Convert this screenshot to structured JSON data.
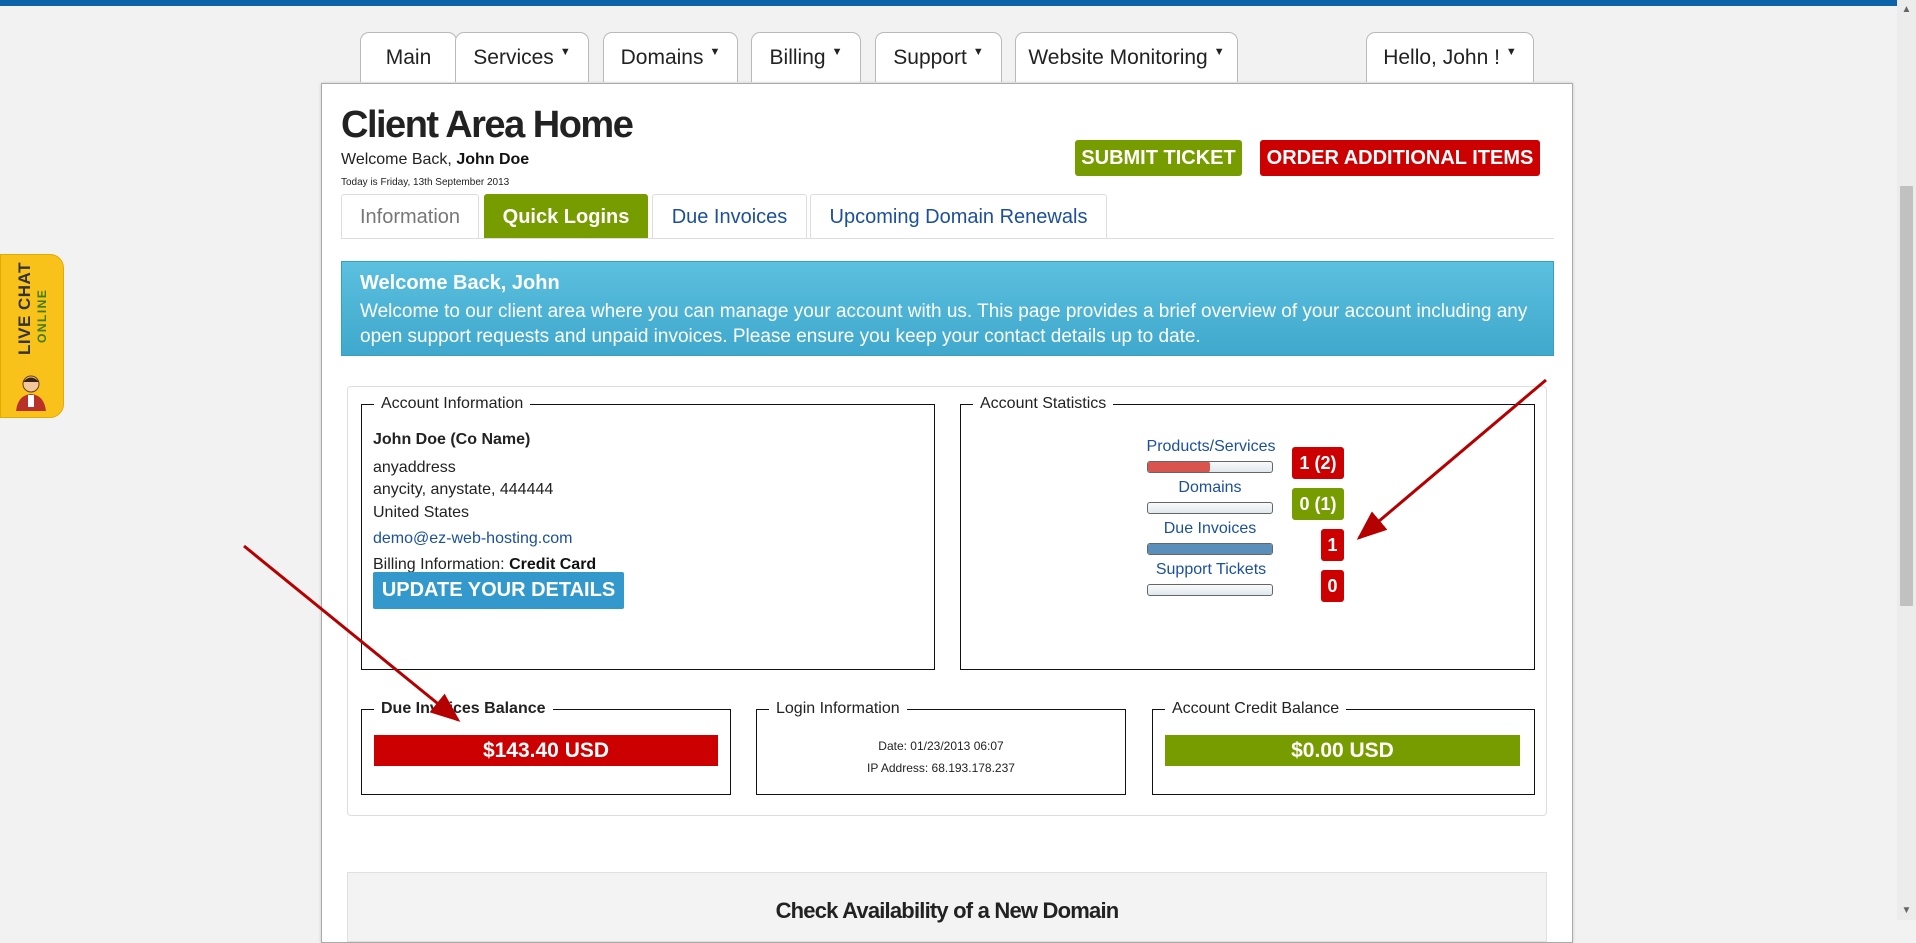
{
  "nav": {
    "main": "Main",
    "services": "Services",
    "domains": "Domains",
    "billing": "Billing",
    "support": "Support",
    "monitoring": "Website Monitoring",
    "user": "Hello, John !"
  },
  "header": {
    "title": "Client Area Home",
    "welcome_prefix": "Welcome Back,",
    "welcome_name": "John Doe",
    "today": "Today is Friday, 13th September 2013",
    "submit_ticket": "SUBMIT TICKET",
    "order_items": "ORDER ADDITIONAL ITEMS"
  },
  "tabs": [
    "Information",
    "Quick Logins",
    "Due Invoices",
    "Upcoming Domain Renewals"
  ],
  "welcome_box": {
    "title": "Welcome Back, John",
    "text": "Welcome to our client area where you can manage your account with us. This page provides a brief overview of your account including any open support requests and unpaid invoices. Please ensure you keep your contact details up to date."
  },
  "account_info": {
    "legend": "Account Information",
    "name": "John Doe (Co Name)",
    "address1": "anyaddress",
    "address2": "anycity, anystate, 444444",
    "country": "United States",
    "email": "demo@ez-web-hosting.com",
    "billing_label": "Billing Information:",
    "billing_value": "Credit Card",
    "update_button": "UPDATE YOUR DETAILS"
  },
  "account_stats": {
    "legend": "Account Statistics",
    "items": [
      {
        "label": "Products/Services",
        "badge": "1 (2)",
        "level": 0.5,
        "bar_color": "#d9534f",
        "badge_color": "#cc0000"
      },
      {
        "label": "Domains",
        "badge": "0 (1)",
        "level": 0.0,
        "bar_color": "#5a9bc0",
        "badge_color": "#779c00"
      },
      {
        "label": "Due Invoices",
        "badge": "1",
        "level": 1.0,
        "bar_color": "#5b8fbb",
        "badge_color": "#cc0000"
      },
      {
        "label": "Support Tickets",
        "badge": "0",
        "level": 0.0,
        "bar_color": "#5a9bc0",
        "badge_color": "#cc0000"
      }
    ]
  },
  "due_balance": {
    "legend": "Due Invoices Balance",
    "value": "$143.40 USD",
    "color": "#cc0000"
  },
  "login_info": {
    "legend": "Login Information",
    "date": "Date: 01/23/2013 06:07",
    "ip": "IP Address: 68.193.178.237"
  },
  "credit_balance": {
    "legend": "Account Credit Balance",
    "value": "$0.00 USD",
    "color": "#779c00"
  },
  "domain_check": {
    "title": "Check Availability of a New Domain"
  },
  "live_chat": {
    "live": "LIVE CHAT",
    "status": "ONLINE"
  }
}
